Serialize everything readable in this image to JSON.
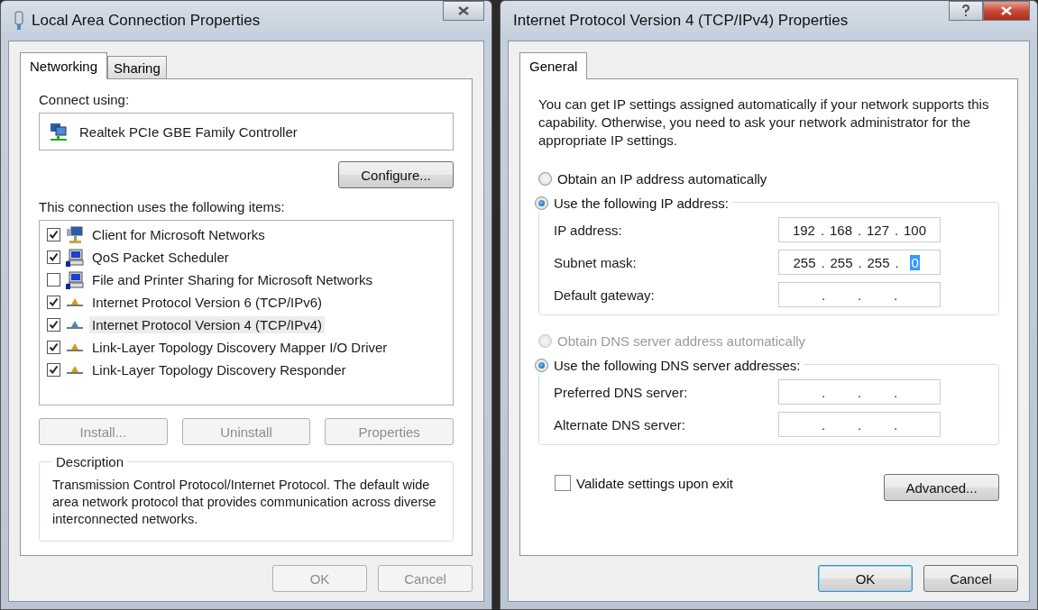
{
  "left_dialog": {
    "title": "Local Area Connection Properties",
    "tabs": [
      {
        "label": "Networking",
        "selected": true
      },
      {
        "label": "Sharing",
        "selected": false
      }
    ],
    "connect_label": "Connect using:",
    "adapter": "Realtek PCIe GBE Family Controller",
    "configure_button": "Configure...",
    "items_label": "This connection uses the following items:",
    "items": [
      {
        "label": "Client for Microsoft Networks",
        "checked": true,
        "selected": false,
        "kind": "client"
      },
      {
        "label": "QoS Packet Scheduler",
        "checked": true,
        "selected": false,
        "kind": "service"
      },
      {
        "label": "File and Printer Sharing for Microsoft Networks",
        "checked": false,
        "selected": false,
        "kind": "service"
      },
      {
        "label": "Internet Protocol Version 6 (TCP/IPv6)",
        "checked": true,
        "selected": false,
        "kind": "protocol"
      },
      {
        "label": "Internet Protocol Version 4 (TCP/IPv4)",
        "checked": true,
        "selected": true,
        "kind": "protocol"
      },
      {
        "label": "Link-Layer Topology Discovery Mapper I/O Driver",
        "checked": true,
        "selected": false,
        "kind": "protocol"
      },
      {
        "label": "Link-Layer Topology Discovery Responder",
        "checked": true,
        "selected": false,
        "kind": "protocol"
      }
    ],
    "action_buttons": [
      {
        "label": "Install...",
        "disabled": true
      },
      {
        "label": "Uninstall",
        "disabled": true
      },
      {
        "label": "Properties",
        "disabled": true
      }
    ],
    "description": {
      "legend": "Description",
      "text": "Transmission Control Protocol/Internet Protocol. The default wide area network protocol that provides communication across diverse interconnected networks."
    },
    "footer_buttons": [
      {
        "label": "OK",
        "disabled": true,
        "default": false
      },
      {
        "label": "Cancel",
        "disabled": true,
        "default": false
      }
    ]
  },
  "right_dialog": {
    "title": "Internet Protocol Version 4 (TCP/IPv4) Properties",
    "tabs": [
      {
        "label": "General",
        "selected": true
      }
    ],
    "intro": "You can get IP settings assigned automatically if your network supports this capability. Otherwise, you need to ask your network administrator for the appropriate IP settings.",
    "separator": ".",
    "sections": [
      {
        "auto_option": {
          "label": "Obtain an IP address automatically",
          "selected": false,
          "disabled": false
        },
        "manual_option": {
          "label": "Use the following IP address:",
          "selected": true,
          "disabled": false
        },
        "fields": [
          {
            "label": "IP address:",
            "octets": [
              {
                "text": "192",
                "selected": false
              },
              {
                "text": "168",
                "selected": false
              },
              {
                "text": "127",
                "selected": false
              },
              {
                "text": "100",
                "selected": false
              }
            ]
          },
          {
            "label": "Subnet mask:",
            "octets": [
              {
                "text": "255",
                "selected": false
              },
              {
                "text": "255",
                "selected": false
              },
              {
                "text": "255",
                "selected": false
              },
              {
                "text": "0",
                "selected": true
              }
            ]
          },
          {
            "label": "Default gateway:",
            "empty": true
          }
        ]
      },
      {
        "auto_option": {
          "label": "Obtain DNS server address automatically",
          "selected": false,
          "disabled": true
        },
        "manual_option": {
          "label": "Use the following DNS server addresses:",
          "selected": true,
          "disabled": false
        },
        "fields": [
          {
            "label": "Preferred DNS server:",
            "empty": true
          },
          {
            "label": "Alternate DNS server:",
            "empty": true
          }
        ]
      }
    ],
    "validate": {
      "label": "Validate settings upon exit",
      "checked": false
    },
    "advanced_button": "Advanced...",
    "footer_buttons": [
      {
        "label": "OK",
        "disabled": false,
        "default": true
      },
      {
        "label": "Cancel",
        "disabled": false,
        "default": false
      }
    ]
  }
}
